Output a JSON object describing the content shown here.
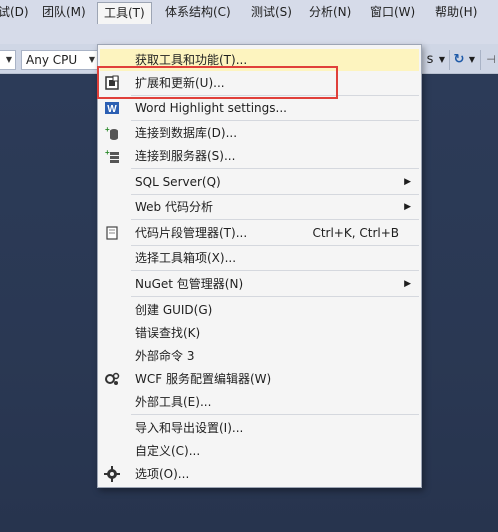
{
  "menubar": {
    "items": [
      "试(D)",
      "团队(M)",
      "工具(T)",
      "体系结构(C)",
      "测试(S)",
      "分析(N)",
      "窗口(W)",
      "帮助(H)"
    ]
  },
  "toolbar": {
    "config_value": "",
    "platform_value": "Any CPU",
    "right_label": "s"
  },
  "tools_menu": {
    "items": [
      {
        "label": "获取工具和功能(T)..."
      },
      {
        "label": "扩展和更新(U)..."
      },
      {
        "label": "Word Highlight settings..."
      },
      {
        "label": "连接到数据库(D)..."
      },
      {
        "label": "连接到服务器(S)..."
      },
      {
        "label": "SQL Server(Q)"
      },
      {
        "label": "Web 代码分析"
      },
      {
        "label": "代码片段管理器(T)...",
        "shortcut": "Ctrl+K, Ctrl+B"
      },
      {
        "label": "选择工具箱项(X)..."
      },
      {
        "label": "NuGet 包管理器(N)"
      },
      {
        "label": "创建 GUID(G)"
      },
      {
        "label": "错误查找(K)"
      },
      {
        "label": "外部命令 3"
      },
      {
        "label": "WCF 服务配置编辑器(W)"
      },
      {
        "label": "外部工具(E)..."
      },
      {
        "label": "导入和导出设置(I)..."
      },
      {
        "label": "自定义(C)..."
      },
      {
        "label": "选项(O)..."
      }
    ]
  },
  "icons": {
    "extensions": "extensions-icon",
    "word": "word-icon",
    "database": "database-icon",
    "server": "server-icon",
    "snippet": "snippet-icon",
    "wcf": "wcf-gear-icon",
    "options": "gear-icon",
    "submenu": "submenu-arrow-icon"
  },
  "colors": {
    "highlight": "#fdf4bf",
    "annotation": "#e0403a",
    "editor_bg": "#2b3a55"
  }
}
